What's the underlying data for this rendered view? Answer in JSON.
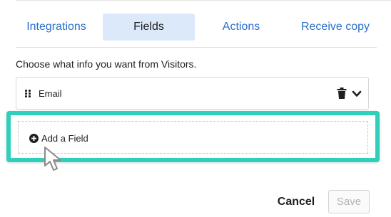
{
  "tabs": [
    {
      "label": "Integrations",
      "active": false
    },
    {
      "label": "Fields",
      "active": true
    },
    {
      "label": "Actions",
      "active": false
    },
    {
      "label": "Receive copy",
      "active": false
    }
  ],
  "prompt": "Choose what info you want from Visitors.",
  "fields": [
    {
      "label": "Email",
      "icons": [
        "drag-handle-icon",
        "trash-icon",
        "chevron-down-icon"
      ]
    }
  ],
  "add_field": {
    "label": "Add a Field",
    "icon": "plus-circle-icon"
  },
  "footer": {
    "cancel_label": "Cancel",
    "save_label": "Save",
    "save_disabled": true
  },
  "colors": {
    "link": "#2a6fc9",
    "active_tab_bg": "#dbe9fb",
    "highlight": "#2fd0bb",
    "text": "#1f1f1f"
  }
}
